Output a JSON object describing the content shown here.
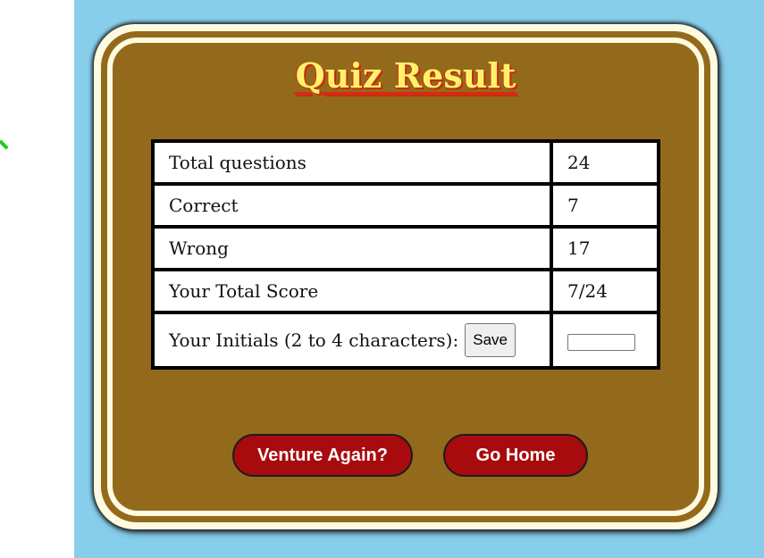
{
  "title": "Quiz Result",
  "results": {
    "rows": [
      {
        "label": "Total questions",
        "value": "24"
      },
      {
        "label": "Correct",
        "value": "7"
      },
      {
        "label": "Wrong",
        "value": "17"
      },
      {
        "label": "Your Total Score",
        "value": "7/24"
      }
    ],
    "initials_label": "Your Initials (2 to 4 characters):",
    "save_label": "Save",
    "initials_value": ""
  },
  "buttons": {
    "venture_again": "Venture Again?",
    "go_home": "Go Home"
  },
  "colors": {
    "sky": "#87ceeb",
    "card": "#936a1c",
    "cream": "#fffbe0",
    "title": "#fff36b",
    "title_outline": "#d62b10",
    "button": "#a80b0e"
  }
}
